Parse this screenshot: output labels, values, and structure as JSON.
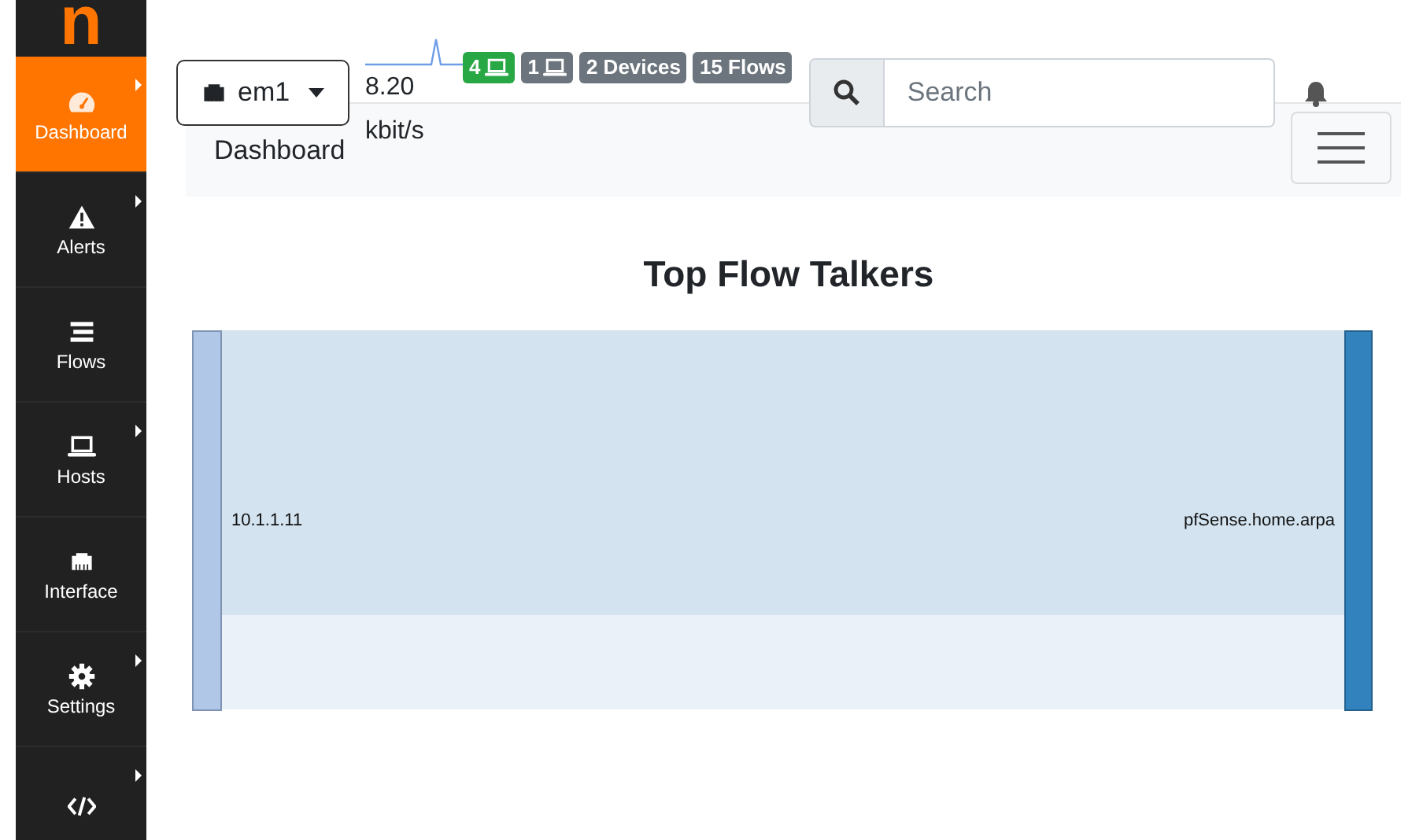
{
  "sidebar": {
    "logo": "n",
    "items": [
      {
        "label": "Dashboard",
        "selected": true,
        "submenu": true
      },
      {
        "label": "Alerts",
        "selected": false,
        "submenu": true
      },
      {
        "label": "Flows",
        "selected": false,
        "submenu": false
      },
      {
        "label": "Hosts",
        "selected": false,
        "submenu": true
      },
      {
        "label": "Interface",
        "selected": false,
        "submenu": false
      },
      {
        "label": "Settings",
        "selected": false,
        "submenu": true
      },
      {
        "selected": false,
        "submenu": true
      }
    ]
  },
  "header": {
    "interface": "em1",
    "throughput": "8.20 kbit/s",
    "badges": [
      {
        "kind": "hosts",
        "text": "4",
        "color": "#28a745"
      },
      {
        "kind": "hosts",
        "text": "1",
        "color": "#6c757d"
      },
      {
        "kind": "count",
        "text": "2 Devices",
        "color": "#6c757d"
      },
      {
        "kind": "count",
        "text": "15 Flows",
        "color": "#6c757d"
      }
    ],
    "search": {
      "placeholder": "Search"
    },
    "breadcrumb": "Dashboard"
  },
  "content": {
    "title": "Top Flow Talkers",
    "source": "10.1.1.11",
    "target": "pfSense.home.arpa"
  }
}
